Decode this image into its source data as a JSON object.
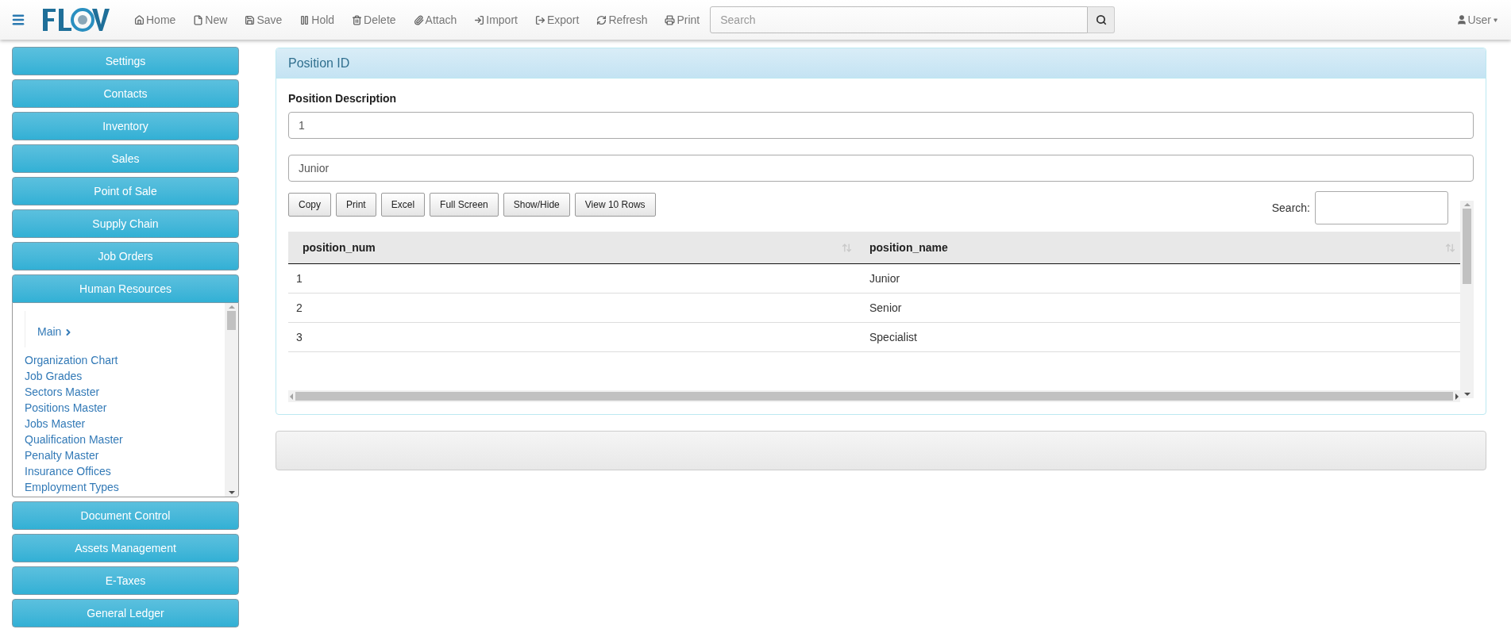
{
  "toolbar": {
    "items": [
      {
        "kind": "home",
        "label": "Home"
      },
      {
        "kind": "new",
        "label": "New"
      },
      {
        "kind": "save",
        "label": "Save"
      },
      {
        "kind": "hold",
        "label": "Hold"
      },
      {
        "kind": "delete",
        "label": "Delete"
      },
      {
        "kind": "attach",
        "label": "Attach"
      },
      {
        "kind": "import",
        "label": "Import"
      },
      {
        "kind": "export",
        "label": "Export"
      },
      {
        "kind": "refresh",
        "label": "Refresh"
      },
      {
        "kind": "print",
        "label": "Print"
      }
    ],
    "search": {
      "placeholder": "Search"
    },
    "user": "User"
  },
  "sidebar": {
    "sections": [
      {
        "label": "Settings",
        "expanded": false
      },
      {
        "label": "Contacts",
        "expanded": false
      },
      {
        "label": "Inventory",
        "expanded": false
      },
      {
        "label": "Sales",
        "expanded": false
      },
      {
        "label": "Point of Sale",
        "expanded": false
      },
      {
        "label": "Supply Chain",
        "expanded": false
      },
      {
        "label": "Job Orders",
        "expanded": false
      },
      {
        "label": "Human Resources",
        "expanded": true,
        "main": "Main",
        "links": [
          "Organization Chart",
          "Job Grades",
          "Sectors Master",
          "Positions Master",
          "Jobs Master",
          "Qualification Master",
          "Penalty Master",
          "Insurance Offices",
          "Employment Types"
        ]
      },
      {
        "label": "Document Control",
        "expanded": false
      },
      {
        "label": "Assets Management",
        "expanded": false
      },
      {
        "label": "E-Taxes",
        "expanded": false
      },
      {
        "label": "General Ledger",
        "expanded": false
      }
    ]
  },
  "panel": {
    "title": "Position ID",
    "field_label": "Position Description",
    "fields": [
      "1",
      "Junior"
    ],
    "buttons": [
      "Copy",
      "Print",
      "Excel",
      "Full Screen",
      "Show/Hide",
      "View 10 Rows"
    ],
    "search_label": "Search:",
    "table": {
      "columns": [
        "position_num",
        "position_name"
      ],
      "rows": [
        [
          "1",
          "Junior"
        ],
        [
          "2",
          "Senior"
        ],
        [
          "3",
          "Specialist"
        ]
      ]
    }
  }
}
